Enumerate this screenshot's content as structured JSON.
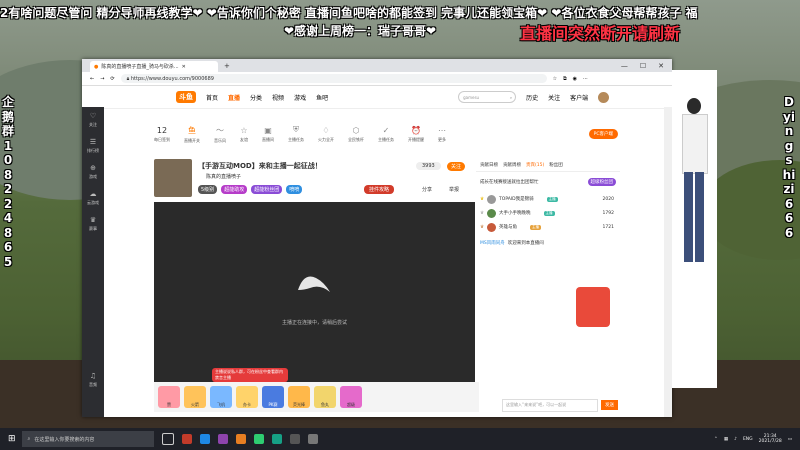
{
  "overlay": {
    "line1": "2有啥问题尽管问 精分导师再线教学❤ ❤告诉你们个秘密 直播间鱼吧啥的都能签到 完事儿还能领宝箱❤ ❤各位衣食父母帮帮孩子 福",
    "line2": "❤感谢上周榜一：瑞子哥哥❤",
    "notice": "直播间突然断开请刷新",
    "left_column": "企鹅群1082248 65",
    "right_column": "Dyingshizi666"
  },
  "browser": {
    "tab_title": "陈真的直播喷子直播_骑马与砍杀...",
    "url": "https://www.douyu.com/9000689",
    "site": {
      "logo": "斗鱼",
      "nav": [
        "首页",
        "直播",
        "分类",
        "视频",
        "游戏",
        "鱼吧"
      ],
      "search_placeholder": "gamesu",
      "header_icons": [
        "历史",
        "关注",
        "客户端"
      ]
    },
    "sidebar": [
      "关注",
      "排行榜",
      "游戏",
      "云游戏",
      "赛事",
      "音频"
    ],
    "categories": [
      {
        "icon": "12",
        "label": "每日签到"
      },
      {
        "icon": "鱼",
        "label": "直播开关"
      },
      {
        "icon": "～",
        "label": "音乐风"
      },
      {
        "icon": "☆",
        "label": "友谊"
      },
      {
        "icon": "▣",
        "label": "直播间"
      },
      {
        "icon": "⛨",
        "label": "主播任务"
      },
      {
        "icon": "♢",
        "label": "火力全开"
      },
      {
        "icon": "⬡",
        "label": "全民铁杆"
      },
      {
        "icon": "✓",
        "label": "主播任务"
      },
      {
        "icon": "⏰",
        "label": "开播提醒"
      },
      {
        "icon": "⋯",
        "label": "更多"
      }
    ],
    "pc_button": "PC客户端",
    "stream": {
      "title": "【手游互动MOD】来和主播一起征战！",
      "streamer": "陈真的直播喷子",
      "follow": "关注",
      "fans": "3993",
      "tags": [
        "5级别",
        "超能助攻",
        "超能粉丝团",
        "喷喷"
      ],
      "pk_button": "挂件攻略",
      "share": "分享",
      "report": "举报"
    },
    "video": {
      "status_text": "主播正在连接中，请稍后尝试",
      "banner": "主播说说私人群，可在粉丝中查看群内禁言主播"
    },
    "gifts": [
      "赞",
      "火箭",
      "飞机",
      "办卡",
      "PK赛",
      "荧光棒",
      "鱼丸",
      "超级"
    ],
    "right_panel": {
      "tabs": [
        "贡献日榜",
        "贡献周榜",
        "贵宾(15)",
        "粉丝团"
      ],
      "banner": "成长在线赛接送就拉出团帮忙",
      "banner_button": "超级粉丝团",
      "ranks": [
        {
          "name": "TOPAID我是锦骑",
          "badge": "主播",
          "score": "2020"
        },
        {
          "name": "大手小手晚晚晚",
          "badge": "主播",
          "score": "1792"
        },
        {
          "name": "英雄与角",
          "badge": "主播",
          "score": "1721"
        }
      ],
      "chat_msg": "欢迎来到本直播间",
      "chat_user": "MS风雨同舟",
      "chat_placeholder": "这里输入“来来说”吧，可以一起说",
      "send": "发送"
    }
  },
  "taskbar": {
    "search_placeholder": "在这里输入你要搜索的内容",
    "time": "21:34",
    "date": "2021/7/28",
    "lang": "ENG"
  }
}
